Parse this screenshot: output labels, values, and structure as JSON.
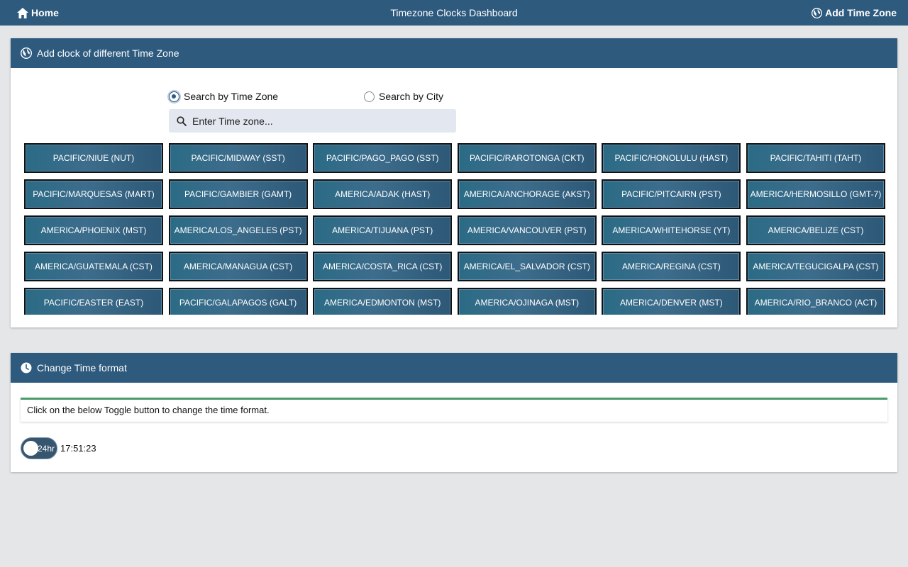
{
  "topbar": {
    "home_label": "Home",
    "title": "Timezone Clocks Dashboard",
    "add_label": "Add Time Zone"
  },
  "add_clock": {
    "header": "Add clock of different Time Zone",
    "radio_timezone": "Search by Time Zone",
    "radio_city": "Search by City",
    "selected": "timezone",
    "search_placeholder": "Enter Time zone...",
    "timezones": [
      "PACIFIC/NIUE (NUT)",
      "PACIFIC/MIDWAY (SST)",
      "PACIFIC/PAGO_PAGO (SST)",
      "PACIFIC/RAROTONGA (CKT)",
      "PACIFIC/HONOLULU (HAST)",
      "PACIFIC/TAHITI (TAHT)",
      "PACIFIC/MARQUESAS (MART)",
      "PACIFIC/GAMBIER (GAMT)",
      "AMERICA/ADAK (HAST)",
      "AMERICA/ANCHORAGE (AKST)",
      "PACIFIC/PITCAIRN (PST)",
      "AMERICA/HERMOSILLO (GMT-7)",
      "AMERICA/PHOENIX (MST)",
      "AMERICA/LOS_ANGELES (PST)",
      "AMERICA/TIJUANA (PST)",
      "AMERICA/VANCOUVER (PST)",
      "AMERICA/WHITEHORSE (YT)",
      "AMERICA/BELIZE (CST)",
      "AMERICA/GUATEMALA (CST)",
      "AMERICA/MANAGUA (CST)",
      "AMERICA/COSTA_RICA (CST)",
      "AMERICA/EL_SALVADOR (CST)",
      "AMERICA/REGINA (CST)",
      "AMERICA/TEGUCIGALPA (CST)",
      "PACIFIC/EASTER (EAST)",
      "PACIFIC/GALAPAGOS (GALT)",
      "AMERICA/EDMONTON (MST)",
      "AMERICA/OJINAGA (MST)",
      "AMERICA/DENVER (MST)",
      "AMERICA/RIO_BRANCO (ACT)"
    ]
  },
  "time_format": {
    "header": "Change Time format",
    "info": "Click on the below Toggle button to change the time format.",
    "toggle_label": "24hr",
    "time": "17:51:23"
  },
  "colors": {
    "header_bg": "#2e5a7e",
    "info_accent": "#4a9d6b"
  },
  "icons": {
    "home": "home-icon",
    "add_timezone": "globe-icon",
    "card1": "globe-icon",
    "card2": "clock-icon",
    "search": "search-icon"
  }
}
